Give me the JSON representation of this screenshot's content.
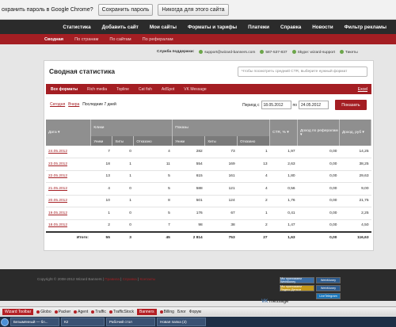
{
  "password_bar": {
    "question": "охранить пароль в Google Chrome?",
    "save": "Сохранить пароль",
    "never": "Никогда для этого сайта"
  },
  "nav": [
    "Статистика",
    "Добавить сайт",
    "Мои сайты",
    "Форматы и тарифы",
    "Платежи",
    "Справка",
    "Новости",
    "Фильтр рекламы"
  ],
  "subnav": [
    "Сводная",
    "По странам",
    "По сайтам",
    "По рефералам"
  ],
  "support": {
    "label": "Служба поддержки:",
    "email": "support@wizard-banners.com",
    "phone": "587-537-837",
    "skype": "Skype: wizard-support",
    "tickets": "Тикеты"
  },
  "card": {
    "title": "Сводная статистика",
    "finder_placeholder": "Чтобы посмотреть средний CTR, выберите нужный формат",
    "tabs": [
      "Все форматы",
      "Rich media",
      "Topline",
      "Cat fish",
      "AdSpot",
      "VK Message"
    ],
    "excel": "Excel",
    "periods": [
      "Сегодня",
      "Вчера",
      "Последние 7 дней"
    ],
    "period_label": "Период с",
    "date_from": "18.05.2012",
    "to": "по",
    "date_to": "24.05.2012",
    "show": "Показать"
  },
  "table": {
    "head": {
      "date": "Дата",
      "clicks": "Клики",
      "shows": "Показы",
      "ctr": "CTR, %",
      "ref_income": "Доход по рефералам",
      "income": "Доход, руб"
    },
    "sub": [
      "Уники",
      "Хиты",
      "Отказано",
      "Уники",
      "Хиты",
      "Отказано"
    ],
    "rows": [
      [
        "24.05.2012",
        "7",
        "0",
        "4",
        "282",
        "73",
        "1",
        "1,97",
        "0,00",
        "14,25"
      ],
      [
        "23.05.2012",
        "18",
        "1",
        "11",
        "554",
        "169",
        "13",
        "2,63",
        "0,00",
        "38,25"
      ],
      [
        "22.05.2012",
        "13",
        "1",
        "5",
        "615",
        "161",
        "4",
        "1,80",
        "0,00",
        "29,63"
      ],
      [
        "21.05.2012",
        "4",
        "0",
        "5",
        "588",
        "121",
        "4",
        "0,56",
        "0,00",
        "9,00"
      ],
      [
        "20.05.2012",
        "10",
        "1",
        "8",
        "501",
        "124",
        "2",
        "1,76",
        "0,00",
        "21,75"
      ],
      [
        "19.05.2012",
        "1",
        "0",
        "5",
        "176",
        "67",
        "1",
        "0,41",
        "0,00",
        "2,25"
      ],
      [
        "18.05.2012",
        "2",
        "0",
        "7",
        "98",
        "38",
        "2",
        "1,47",
        "0,00",
        "4,50"
      ]
    ],
    "total": [
      "Итого:",
      "55",
      "3",
      "45",
      "2 814",
      "753",
      "27",
      "1,63",
      "0,00",
      "116,63"
    ]
  },
  "footer": {
    "copyright": "Copyright © 2008-2012 Wizard Banners |",
    "links": [
      "Правила",
      "Справка",
      "Контакты"
    ],
    "badges": [
      "Мы принимаем WebMoney",
      "WebMoney",
      "Мы принимаем Яндекс.Деньги",
      "WebMoney",
      "LiveTelegram"
    ]
  },
  "toolbar": [
    "Wizard Toolbar",
    "Globo",
    "Packer",
    "Agent",
    "Traffic",
    "TrafficStock",
    "Banners",
    "Billing",
    "Блог",
    "Форум"
  ],
  "vk": "message",
  "taskbar": [
    "Безымянный — бл...",
    "К2",
    "Рабочий стол",
    "Новая папка (2)"
  ],
  "colors": {
    "brand": "#a41e23",
    "nav": "#2b2b2b"
  }
}
